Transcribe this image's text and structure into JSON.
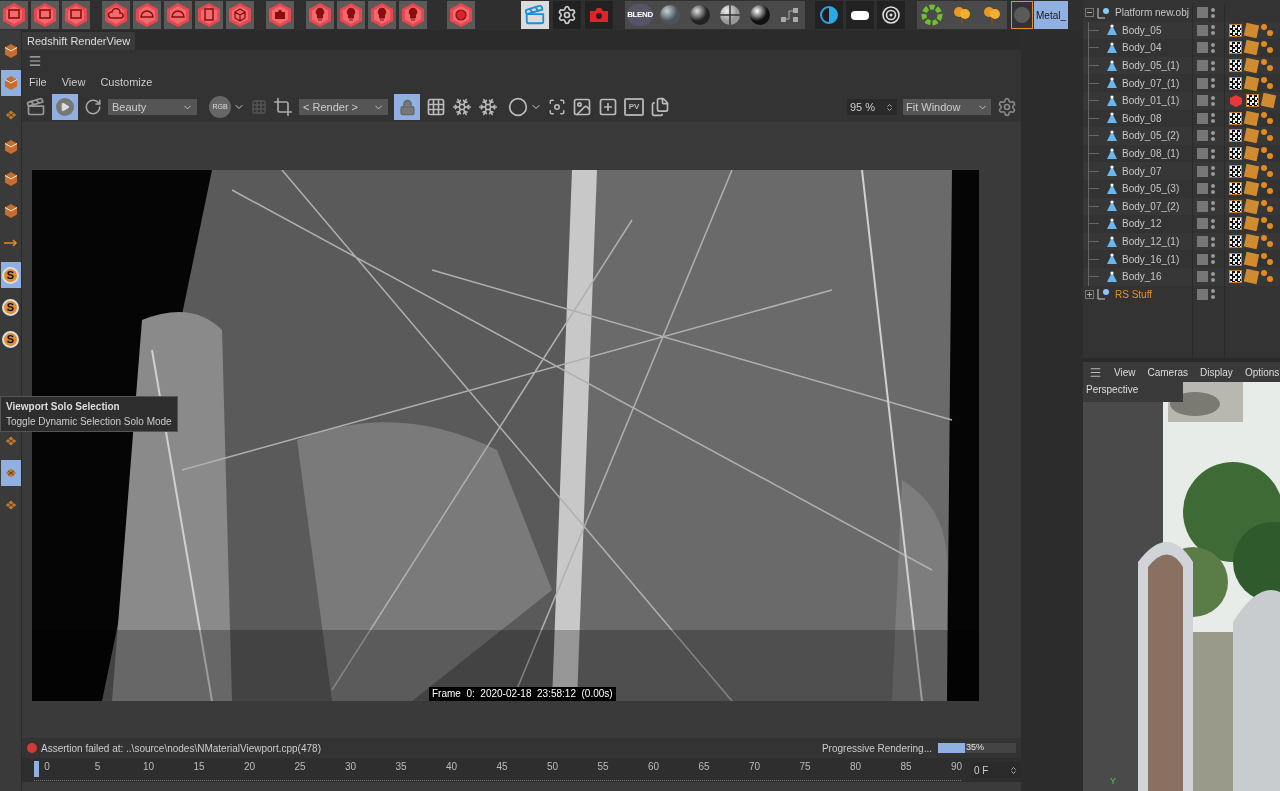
{
  "top_toolbar": {
    "material_label": "Metal_"
  },
  "material_icons": [
    {
      "label": "BLEND"
    }
  ],
  "left_toolbar": {
    "items": [
      {
        "kind": "cube",
        "selected": false
      },
      {
        "kind": "cube",
        "selected": true
      },
      {
        "kind": "checker",
        "selected": false
      },
      {
        "kind": "cube",
        "selected": false
      },
      {
        "kind": "cube",
        "selected": false
      },
      {
        "kind": "cube",
        "selected": false
      },
      {
        "kind": "arrow",
        "selected": false
      },
      {
        "kind": "solo",
        "label": "S",
        "selected": true
      },
      {
        "kind": "solo",
        "label": "S",
        "selected": false
      },
      {
        "kind": "solo",
        "label": "S",
        "selected": false
      }
    ],
    "lower_items": [
      {
        "kind": "checker",
        "selected": false
      },
      {
        "kind": "checker",
        "selected": true
      },
      {
        "kind": "checker",
        "selected": false
      }
    ]
  },
  "render_view": {
    "tab": "Redshift RenderView",
    "menu": [
      "File",
      "View",
      "Customize"
    ],
    "toolbar": {
      "aov": "Beauty",
      "rgb": "RGB",
      "camera": "< Render >",
      "lock_on": true,
      "pv": "PV",
      "zoom": "95 %",
      "fit": "Fit Window"
    },
    "frame_info": "Frame  0:  2020-02-18  23:58:12  (0.00s)",
    "status": {
      "message": "Assertion failed at: ..\\source\\nodes\\NMaterialViewport.cpp(478)",
      "progress_label": "Progressive Rendering...",
      "level": 0.35,
      "percent": "35%"
    }
  },
  "tooltip": {
    "title": "Viewport Solo Selection",
    "description": "Toggle Dynamic Selection Solo Mode"
  },
  "timeline": {
    "ticks": [
      "0",
      "5",
      "10",
      "15",
      "20",
      "25",
      "30",
      "35",
      "40",
      "45",
      "50",
      "55",
      "60",
      "65",
      "70",
      "75",
      "80",
      "85",
      "90"
    ],
    "level": 0,
    "frame": "0 F"
  },
  "object_manager": {
    "items": [
      {
        "name": "Platform new.obj",
        "expanded": true,
        "color": "#c8c8c8",
        "children": [
          {
            "name": "Body_05",
            "tags": [
              {
                "kind": "checker"
              },
              {
                "kind": "texture"
              },
              {
                "kind": "spheres"
              }
            ]
          },
          {
            "name": "Body_04",
            "tags": [
              {
                "kind": "checker"
              },
              {
                "kind": "texture"
              },
              {
                "kind": "spheres"
              }
            ]
          },
          {
            "name": "Body_05_(1)",
            "tags": [
              {
                "kind": "checker"
              },
              {
                "kind": "texture"
              },
              {
                "kind": "spheres"
              }
            ]
          },
          {
            "name": "Body_07_(1)",
            "tags": [
              {
                "kind": "checker"
              },
              {
                "kind": "texture"
              },
              {
                "kind": "spheres"
              }
            ]
          },
          {
            "name": "Body_01_(1)",
            "tags": [
              {
                "kind": "redcube"
              },
              {
                "kind": "checker"
              },
              {
                "kind": "texture"
              }
            ]
          },
          {
            "name": "Body_08",
            "tags": [
              {
                "kind": "checker"
              },
              {
                "kind": "texture"
              },
              {
                "kind": "spheres"
              }
            ]
          },
          {
            "name": "Body_05_(2)",
            "tags": [
              {
                "kind": "checker"
              },
              {
                "kind": "texture"
              },
              {
                "kind": "spheres"
              }
            ]
          },
          {
            "name": "Body_08_(1)",
            "tags": [
              {
                "kind": "checker"
              },
              {
                "kind": "texture"
              },
              {
                "kind": "spheres"
              }
            ]
          },
          {
            "name": "Body_07",
            "tags": [
              {
                "kind": "checker"
              },
              {
                "kind": "texture"
              },
              {
                "kind": "spheres"
              }
            ]
          },
          {
            "name": "Body_05_(3)",
            "tags": [
              {
                "kind": "checker"
              },
              {
                "kind": "texture"
              },
              {
                "kind": "spheres"
              }
            ]
          },
          {
            "name": "Body_07_(2)",
            "tags": [
              {
                "kind": "checker"
              },
              {
                "kind": "texture"
              },
              {
                "kind": "spheres"
              }
            ]
          },
          {
            "name": "Body_12",
            "tags": [
              {
                "kind": "checker"
              },
              {
                "kind": "texture"
              },
              {
                "kind": "spheres"
              }
            ]
          },
          {
            "name": "Body_12_(1)",
            "tags": [
              {
                "kind": "checker"
              },
              {
                "kind": "texture"
              },
              {
                "kind": "spheres"
              }
            ]
          },
          {
            "name": "Body_16_(1)",
            "tags": [
              {
                "kind": "checker"
              },
              {
                "kind": "texture"
              },
              {
                "kind": "spheres"
              }
            ]
          },
          {
            "name": "Body_16",
            "tags": [
              {
                "kind": "checker"
              },
              {
                "kind": "texture"
              },
              {
                "kind": "spheres"
              }
            ]
          }
        ]
      },
      {
        "name": "RS Stuff",
        "expanded": false,
        "color": "#e0902e"
      }
    ]
  },
  "viewport": {
    "menu": [
      "View",
      "Cameras",
      "Display",
      "Options"
    ],
    "camera_label": "Perspective",
    "axis_label": "Y"
  }
}
